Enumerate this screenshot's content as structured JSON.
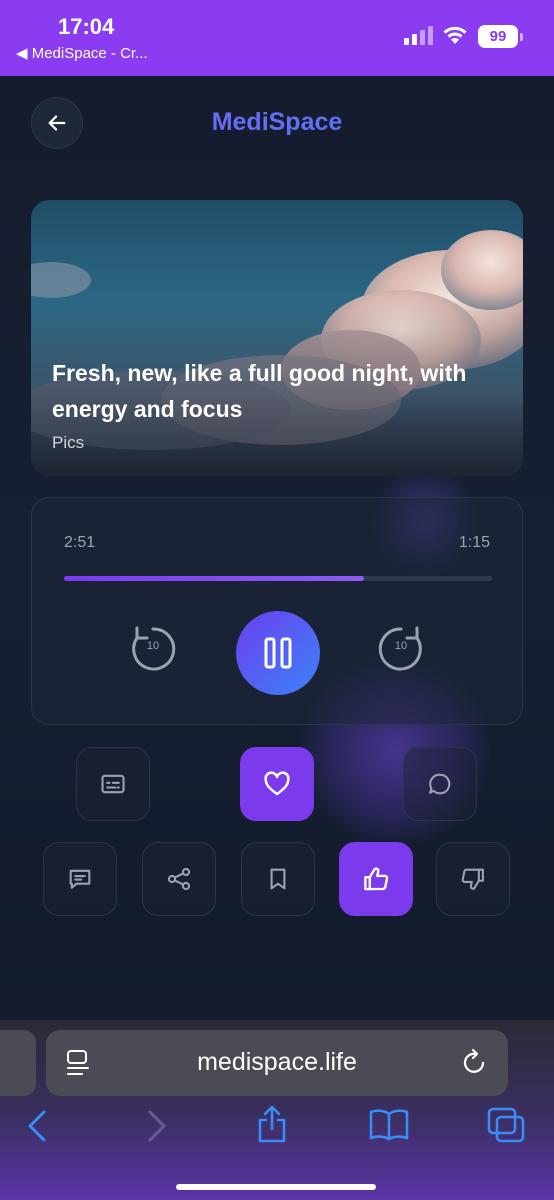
{
  "status_bar": {
    "time": "17:04",
    "back_label": "◀ MediSpace - Cr...",
    "battery": "99",
    "signal_icon": "cellular-signal-icon",
    "wifi_icon": "wifi-icon",
    "background": "#8b3cf0"
  },
  "header": {
    "title": "MediSpace",
    "back_icon": "arrow-left-icon"
  },
  "hero": {
    "title": "Fresh, new, like a full good night, with energy and focus",
    "subtitle": "Pics"
  },
  "player": {
    "elapsed": "2:51",
    "remaining": "1:15",
    "progress": 0.7,
    "rewind_label": "10",
    "forward_label": "10",
    "state": "playing",
    "accent": "#7c3aed"
  },
  "actions": {
    "row1": [
      {
        "icon": "subtitles-icon",
        "active": false
      },
      {
        "icon": "heart-icon",
        "active": true
      },
      {
        "icon": "chat-bubble-icon",
        "active": false
      }
    ],
    "row2": [
      {
        "icon": "message-icon",
        "active": false
      },
      {
        "icon": "share-icon",
        "active": false
      },
      {
        "icon": "bookmark-icon",
        "active": false
      },
      {
        "icon": "thumbs-up-icon",
        "active": true
      },
      {
        "icon": "thumbs-down-icon",
        "active": false
      }
    ]
  },
  "browser": {
    "url": "medispace.life",
    "nav_icons": [
      "back-arrow-icon",
      "forward-arrow-icon",
      "share-icon",
      "bookmarks-icon",
      "tabs-icon"
    ]
  }
}
